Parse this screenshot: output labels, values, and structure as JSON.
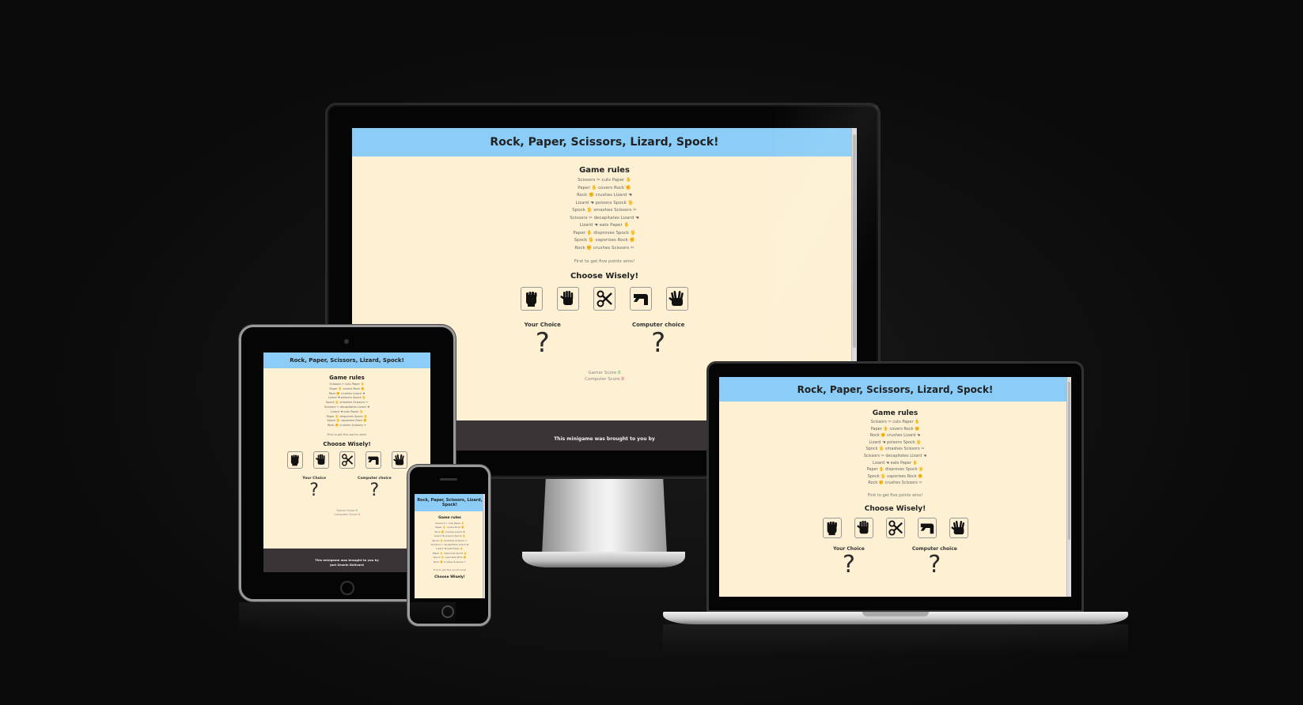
{
  "site": {
    "title": "Rock, Paper, Scissors, Lizard, Spock!",
    "rules_heading": "Game rules",
    "rules": [
      "Scissors ✂ cuts Paper ✋",
      "Paper ✋ covers Rock ✊",
      "Rock ✊ crushes Lizard ☚",
      "Lizard ☚ poisons Spock 🖖",
      "Spock 🖖 smashes Scissors ✂",
      "Scissors ✂ decapitates Lizard ☚",
      "Lizard ☚ eats Paper ✋",
      "Paper ✋ disproves Spock 🖖",
      "Spock 🖖 vaporises Rock ✊",
      "Rock ✊ crushes Scissors ✂"
    ],
    "win_note": "First to get five points wins!",
    "choose_heading": "Choose Wisely!",
    "buttons": [
      {
        "name": "rock",
        "icon": "rock-icon"
      },
      {
        "name": "paper",
        "icon": "paper-icon"
      },
      {
        "name": "scissors",
        "icon": "scissors-icon"
      },
      {
        "name": "lizard",
        "icon": "lizard-icon"
      },
      {
        "name": "spock",
        "icon": "spock-icon"
      }
    ],
    "your_choice_label": "Your Choice",
    "computer_choice_label": "Computer choice",
    "choice_placeholder": "?",
    "gamer_score_label": "Gamer Score",
    "gamer_score_value": "0",
    "computer_score_label": "Computer Score",
    "computer_score_value": "0",
    "footer_line1": "This minigame was brought to you by",
    "footer_tablet_line1": "This minigame was brought to you by",
    "footer_tablet_line2": "Joel Granin Dellvard"
  },
  "colors": {
    "header_bg": "#8bcdf7",
    "page_bg": "#fdf0d3",
    "footer_bg": "#3a3437",
    "backdrop": "#0c0c0c"
  }
}
